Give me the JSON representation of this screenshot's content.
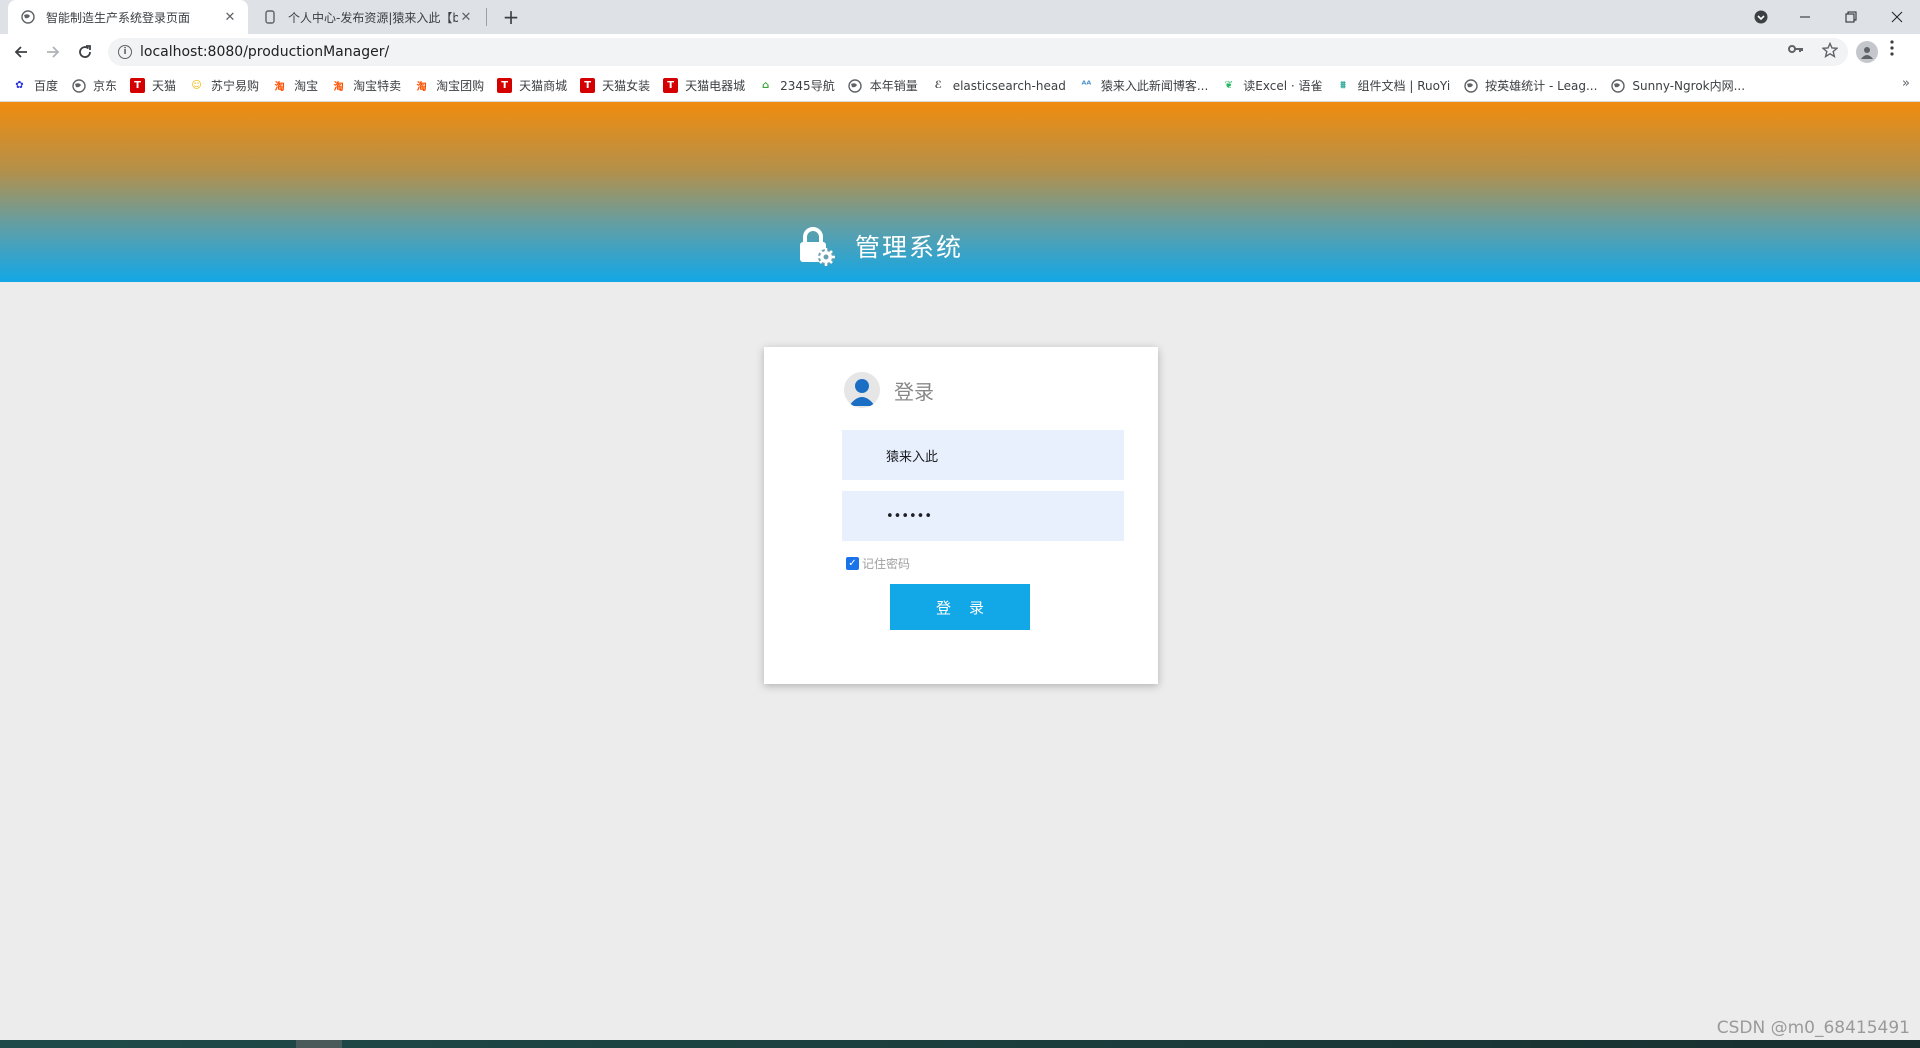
{
  "browser": {
    "tabs": [
      {
        "title": "智能制造生产系统登录页面",
        "icon": "globe-icon",
        "active": true
      },
      {
        "title": "个人中心-发布资源|猿来入此【b",
        "icon": "document-icon",
        "active": false
      }
    ],
    "close_glyph": "✕",
    "new_tab_glyph": "+",
    "url": "localhost:8080/productionManager/"
  },
  "bookmarks": [
    {
      "label": "百度",
      "icon": "baidu-paw-icon",
      "color": "#2932e1",
      "glyph": "✿"
    },
    {
      "label": "京东",
      "icon": "globe-icon",
      "color": "#5f6368",
      "glyph": ""
    },
    {
      "label": "天猫",
      "icon": "tmall-icon",
      "color": "#d40000",
      "glyph": "T"
    },
    {
      "label": "苏宁易购",
      "icon": "suning-icon",
      "color": "#f5b400",
      "glyph": "☺"
    },
    {
      "label": "淘宝",
      "icon": "taobao-icon",
      "color": "#ff5000",
      "glyph": "淘"
    },
    {
      "label": "淘宝特卖",
      "icon": "taobao-icon",
      "color": "#ff5000",
      "glyph": "淘"
    },
    {
      "label": "淘宝团购",
      "icon": "taobao-icon",
      "color": "#ff5000",
      "glyph": "淘"
    },
    {
      "label": "天猫商城",
      "icon": "tmall-icon",
      "color": "#d40000",
      "glyph": "T"
    },
    {
      "label": "天猫女装",
      "icon": "tmall-icon",
      "color": "#d40000",
      "glyph": "T"
    },
    {
      "label": "天猫电器城",
      "icon": "tmall-icon",
      "color": "#d40000",
      "glyph": "T"
    },
    {
      "label": "2345导航",
      "icon": "house-icon",
      "color": "#3aa53a",
      "glyph": "⌂"
    },
    {
      "label": "本年销量",
      "icon": "globe-icon",
      "color": "#5f6368",
      "glyph": ""
    },
    {
      "label": "elasticsearch-head",
      "icon": "elasticsearch-icon",
      "color": "#3c4043",
      "glyph": "ℰ"
    },
    {
      "label": "猿来入此新闻博客...",
      "icon": "monkey-icon",
      "color": "#4a90c8",
      "glyph": "ᴬᴬ"
    },
    {
      "label": "读Excel · 语雀",
      "icon": "yuque-icon",
      "color": "#25b864",
      "glyph": "❦"
    },
    {
      "label": "组件文档 | RuoYi",
      "icon": "ruoyi-icon",
      "color": "#2fa89a",
      "glyph": "⩩"
    },
    {
      "label": "按英雄统计 - Leag...",
      "icon": "globe-icon",
      "color": "#5f6368",
      "glyph": ""
    },
    {
      "label": "Sunny-Ngrok内网...",
      "icon": "globe-icon",
      "color": "#5f6368",
      "glyph": ""
    }
  ],
  "header": {
    "title": "管理系统"
  },
  "login": {
    "title": "登录",
    "username_value": "猿来入此",
    "password_value": "••••••",
    "remember_label": "记住密码",
    "remember_checked": true,
    "button_label": "登录"
  },
  "watermark": "CSDN @m0_68415491",
  "colors": {
    "banner_top": "#f08c0e",
    "banner_bottom": "#12a7e6",
    "button": "#12a7e6",
    "input_bg": "#e8f0fe"
  }
}
